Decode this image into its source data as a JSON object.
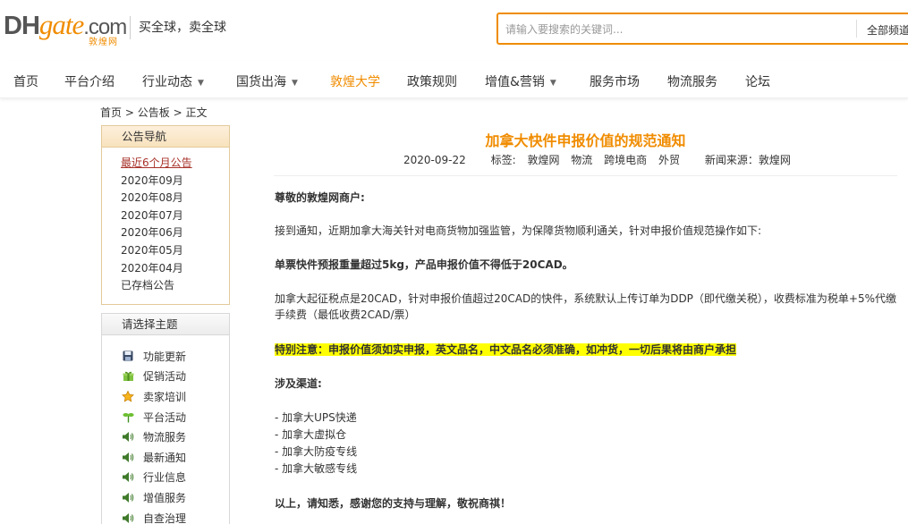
{
  "header": {
    "logo": {
      "dh": "DH",
      "gate": "gate",
      "com": ".com",
      "cn": "敦煌网"
    },
    "slogan": "买全球，卖全球",
    "search": {
      "placeholder": "请输入要搜索的关键词...",
      "channel": "全部频道"
    }
  },
  "nav": {
    "items": [
      {
        "label": "首页"
      },
      {
        "label": "平台介绍"
      },
      {
        "label": "行业动态",
        "dropdown": true
      },
      {
        "label": "国货出海",
        "dropdown": true
      },
      {
        "label": "敦煌大学",
        "active": true
      },
      {
        "label": "政策规则"
      },
      {
        "label": "增值&营销",
        "dropdown": true
      },
      {
        "label": "服务市场"
      },
      {
        "label": "物流服务"
      },
      {
        "label": "论坛"
      }
    ]
  },
  "breadcrumb": {
    "home": "首页",
    "sep": ">",
    "board": "公告板",
    "current": "正文"
  },
  "sidebar": {
    "notice_nav": {
      "title": "公告导航",
      "items": [
        "最近6个月公告",
        "2020年09月",
        "2020年08月",
        "2020年07月",
        "2020年06月",
        "2020年05月",
        "2020年04月",
        "已存档公告"
      ]
    },
    "topics": {
      "title": "请选择主题",
      "items": [
        {
          "label": "功能更新",
          "icon": "floppy-disk-icon"
        },
        {
          "label": "促销活动",
          "icon": "gift-icon"
        },
        {
          "label": "卖家培训",
          "icon": "star-badge-icon"
        },
        {
          "label": "平台活动",
          "icon": "sprout-icon"
        },
        {
          "label": "物流服务",
          "icon": "speaker-icon"
        },
        {
          "label": "最新通知",
          "icon": "speaker-icon"
        },
        {
          "label": "行业信息",
          "icon": "speaker-icon"
        },
        {
          "label": "增值服务",
          "icon": "speaker-icon"
        },
        {
          "label": "自查治理",
          "icon": "speaker-icon"
        }
      ]
    }
  },
  "article": {
    "title": "加拿大快件申报价值的规范通知",
    "date": "2020-09-22",
    "tags_label": "标签:",
    "tags": [
      "敦煌网",
      "物流",
      "跨境电商",
      "外贸"
    ],
    "source": "新闻来源：敦煌网",
    "greeting": "尊敬的敦煌网商户:",
    "p1": "接到通知，近期加拿大海关针对电商货物加强监管，为保障货物顺利通关，针对申报价值规范操作如下:",
    "p2": "单票快件预报重量超过5kg，产品申报价值不得低于20CAD。",
    "p3": "加拿大起征税点是20CAD，针对申报价值超过20CAD的快件，系统默认上传订单为DDP（即代缴关税），收费标准为税单+5%代缴手续费（最低收费2CAD/票）",
    "notice": "特别注意：申报价值须如实申报，英文品名，中文品名必须准确，如冲货，一切后果将由商户承担",
    "channels_title": "涉及渠道:",
    "channels": [
      "- 加拿大UPS快递",
      "- 加拿大虚拟仓",
      "- 加拿大防疫专线",
      "- 加拿大敏感专线"
    ],
    "closing": "以上，请知悉，感谢您的支持与理解，敬祝商祺！"
  },
  "colors": {
    "accent": "#f08c00",
    "highlight": "#ffff00",
    "current_link": "#a8322a"
  }
}
